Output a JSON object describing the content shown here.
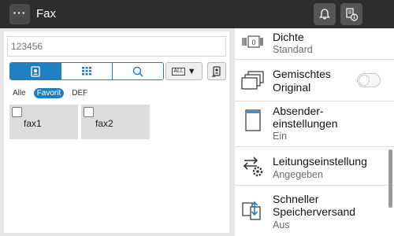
{
  "header": {
    "menu_label": "···",
    "title": "Fax"
  },
  "destination": {
    "value": "",
    "placeholder": "123456"
  },
  "search_modes": [
    "address-book-icon",
    "numeric-keypad-icon",
    "search-icon"
  ],
  "all_select": {
    "label": "ALL"
  },
  "filters": [
    {
      "label": "Alle",
      "active": false
    },
    {
      "label": "Favorit",
      "active": true
    },
    {
      "label": "DEF",
      "active": false
    }
  ],
  "destinations": [
    {
      "label": "fax1"
    },
    {
      "label": "fax2"
    }
  ],
  "settings": {
    "density": {
      "title": "Dichte",
      "value": "Standard"
    },
    "mixed_original": {
      "title_1": "Gemischtes",
      "title_2": "Original",
      "toggle_on": false
    },
    "sender_settings": {
      "title_1": "Absender-",
      "title_2": "einstellungen",
      "value": "Ein"
    },
    "line_settings": {
      "title": "Leitungseinstellung",
      "value": "Angegeben"
    },
    "quick_memory_tx": {
      "title_1": "Schneller",
      "title_2": "Speicherversand",
      "value": "Aus"
    }
  },
  "colors": {
    "accent": "#1f7fc0",
    "topbar": "#2d2d2d"
  }
}
